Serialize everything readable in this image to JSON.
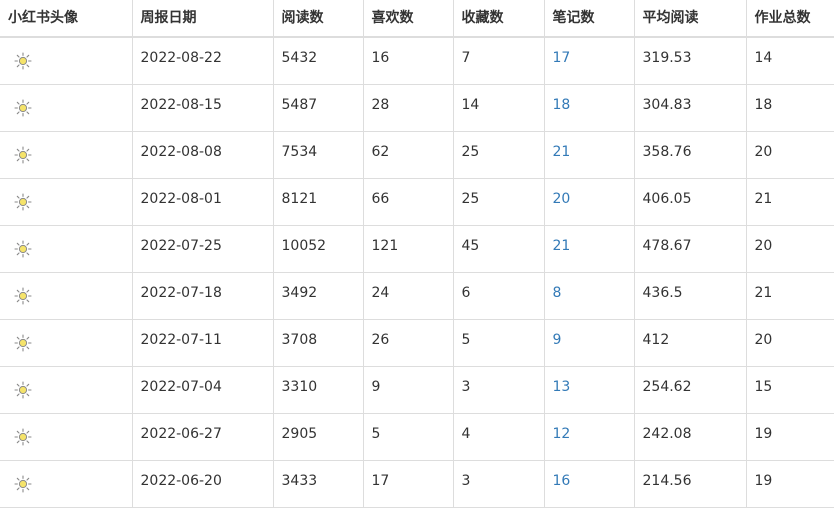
{
  "colors": {
    "text": "#333333",
    "link": "#337ab7",
    "border": "#dddddd",
    "icon_fill": "#f5e36a",
    "icon_stroke": "#8a8a8a"
  },
  "table": {
    "headers": [
      "小红书头像",
      "周报日期",
      "阅读数",
      "喜欢数",
      "收藏数",
      "笔记数",
      "平均阅读",
      "作业总数"
    ],
    "avatar_icon": "sun-icon",
    "rows": [
      {
        "date": "2022-08-22",
        "reads": "5432",
        "likes": "16",
        "favorites": "7",
        "notes": "17",
        "avg_reads": "319.53",
        "homework": "14"
      },
      {
        "date": "2022-08-15",
        "reads": "5487",
        "likes": "28",
        "favorites": "14",
        "notes": "18",
        "avg_reads": "304.83",
        "homework": "18"
      },
      {
        "date": "2022-08-08",
        "reads": "7534",
        "likes": "62",
        "favorites": "25",
        "notes": "21",
        "avg_reads": "358.76",
        "homework": "20"
      },
      {
        "date": "2022-08-01",
        "reads": "8121",
        "likes": "66",
        "favorites": "25",
        "notes": "20",
        "avg_reads": "406.05",
        "homework": "21"
      },
      {
        "date": "2022-07-25",
        "reads": "10052",
        "likes": "121",
        "favorites": "45",
        "notes": "21",
        "avg_reads": "478.67",
        "homework": "20"
      },
      {
        "date": "2022-07-18",
        "reads": "3492",
        "likes": "24",
        "favorites": "6",
        "notes": "8",
        "avg_reads": "436.5",
        "homework": "21"
      },
      {
        "date": "2022-07-11",
        "reads": "3708",
        "likes": "26",
        "favorites": "5",
        "notes": "9",
        "avg_reads": "412",
        "homework": "20"
      },
      {
        "date": "2022-07-04",
        "reads": "3310",
        "likes": "9",
        "favorites": "3",
        "notes": "13",
        "avg_reads": "254.62",
        "homework": "15"
      },
      {
        "date": "2022-06-27",
        "reads": "2905",
        "likes": "5",
        "favorites": "4",
        "notes": "12",
        "avg_reads": "242.08",
        "homework": "19"
      },
      {
        "date": "2022-06-20",
        "reads": "3433",
        "likes": "17",
        "favorites": "3",
        "notes": "16",
        "avg_reads": "214.56",
        "homework": "19"
      }
    ]
  }
}
